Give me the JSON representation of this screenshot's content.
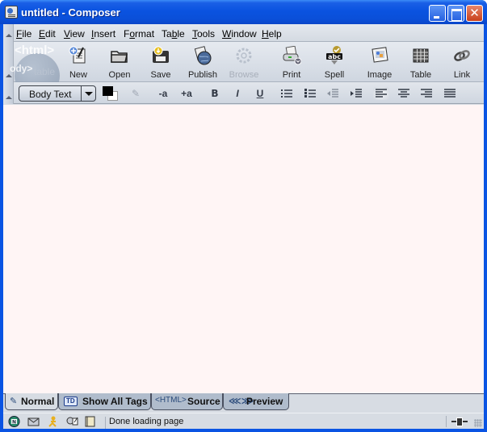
{
  "window": {
    "title": "untitled - Composer",
    "icon": "composer-app-icon",
    "controls": {
      "minimize": "minimize-icon",
      "maximize": "maximize-icon",
      "close": "close-icon"
    }
  },
  "menubar": {
    "items": [
      {
        "label": "File",
        "mnemonic": "F"
      },
      {
        "label": "Edit",
        "mnemonic": "E"
      },
      {
        "label": "View",
        "mnemonic": "V"
      },
      {
        "label": "Insert",
        "mnemonic": "I"
      },
      {
        "label": "Format",
        "mnemonic": "o"
      },
      {
        "label": "Table",
        "mnemonic": "b"
      },
      {
        "label": "Tools",
        "mnemonic": "T"
      },
      {
        "label": "Window",
        "mnemonic": "W"
      },
      {
        "label": "Help",
        "mnemonic": "H"
      }
    ]
  },
  "toolbar": {
    "throbber": {
      "text1": "<html>",
      "text2": "ody>",
      "text3": "table"
    },
    "buttons": [
      {
        "label": "New",
        "icon": "new-page-icon",
        "enabled": true
      },
      {
        "label": "Open",
        "icon": "folder-icon",
        "enabled": true
      },
      {
        "label": "Save",
        "icon": "floppy-disk-icon",
        "enabled": true
      },
      {
        "label": "Publish",
        "icon": "globe-publish-icon",
        "enabled": true
      },
      {
        "label": "Browse",
        "icon": "browse-gear-icon",
        "enabled": false
      },
      {
        "label": "Print",
        "icon": "printer-icon",
        "enabled": true
      },
      {
        "label": "Spell",
        "icon": "spellcheck-abc-icon",
        "enabled": true
      },
      {
        "label": "Image",
        "icon": "image-icon",
        "enabled": true
      },
      {
        "label": "Table",
        "icon": "table-grid-icon",
        "enabled": true
      },
      {
        "label": "Link",
        "icon": "chain-link-icon",
        "enabled": true
      }
    ]
  },
  "format_toolbar": {
    "paragraph_style": "Body Text",
    "text_color": "#000000",
    "background_color": "#ffffff",
    "buttons": [
      {
        "name": "highlight",
        "glyph": "✎",
        "enabled": false
      },
      {
        "name": "smaller-font",
        "glyph": "-a",
        "enabled": true
      },
      {
        "name": "larger-font",
        "glyph": "+a",
        "enabled": true
      },
      {
        "name": "bold",
        "glyph": "B",
        "enabled": true
      },
      {
        "name": "italic",
        "glyph": "I",
        "enabled": true
      },
      {
        "name": "underline",
        "glyph": "U",
        "enabled": true
      }
    ],
    "lists": [
      "bullet-list",
      "numbered-list"
    ],
    "indent": [
      "outdent",
      "indent"
    ],
    "align": {
      "options": [
        "left",
        "center",
        "right",
        "justify"
      ],
      "active": "left"
    }
  },
  "editor": {
    "background": "#fff5f5",
    "content": ""
  },
  "mode_tabs": [
    {
      "label": "Normal",
      "icon": "pencil-icon",
      "active": true
    },
    {
      "label": "Show All Tags",
      "icon_text": "TD",
      "active": false
    },
    {
      "label": "Source",
      "icon_text": "<HTML>",
      "active": false
    },
    {
      "label": "Preview",
      "icon": "preview-icon",
      "active": false
    }
  ],
  "statusbar": {
    "text": "Done loading page",
    "icons": [
      "navigator-icon",
      "mail-icon",
      "instant-messenger-icon",
      "composer-icon",
      "address-book-icon"
    ],
    "online_status": "online-plug-icon"
  }
}
